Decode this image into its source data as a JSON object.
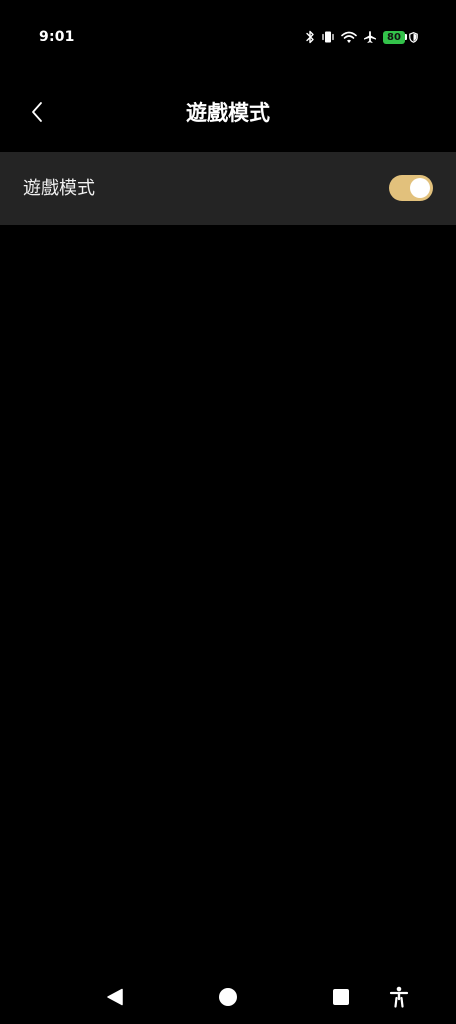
{
  "status_bar": {
    "time": "9:01",
    "icons": [
      "bluetooth-icon",
      "vibrate-icon",
      "wifi-icon",
      "airplane-icon",
      "battery-icon",
      "shield-icon"
    ],
    "battery_level": "80",
    "battery_color": "#33c24a"
  },
  "header": {
    "back_icon": "chevron-left-icon",
    "title": "遊戲模式"
  },
  "settings": [
    {
      "label": "遊戲模式",
      "toggle_on": true,
      "toggle_color": "#e2c17c"
    }
  ],
  "nav_bar": {
    "buttons": [
      "back-triangle-icon",
      "home-circle-icon",
      "recents-square-icon",
      "accessibility-icon"
    ]
  },
  "colors": {
    "background": "#000000",
    "row_background": "#242424",
    "text": "#ffffff"
  }
}
